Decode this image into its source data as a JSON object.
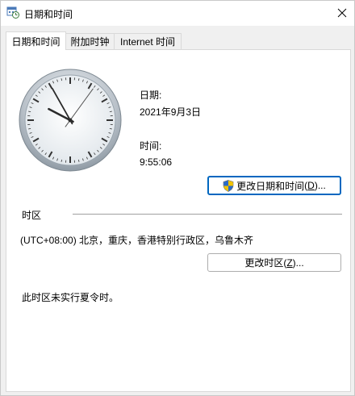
{
  "window": {
    "title": "日期和时间",
    "close_glyph": "✕"
  },
  "tabs": [
    {
      "label": "日期和时间",
      "active": true
    },
    {
      "label": "附加时钟",
      "active": false
    },
    {
      "label": "Internet 时间",
      "active": false
    }
  ],
  "datetime": {
    "date_label": "日期:",
    "date_value": "2021年9月3日",
    "time_label": "时间:",
    "time_value": "9:55:06",
    "change_button_text": "更改日期和时间",
    "change_button_hotkey": "D",
    "change_button_suffix": "...",
    "shield_icon": "uac-shield-icon"
  },
  "timezone": {
    "group_label": "时区",
    "value": "(UTC+08:00) 北京，重庆，香港特别行政区，乌鲁木齐",
    "change_button_text": "更改时区",
    "change_button_hotkey": "Z",
    "change_button_suffix": "...",
    "dst_note": "此时区未实行夏令时。"
  },
  "clock": {
    "hours": 9,
    "minutes": 55,
    "seconds": 6
  },
  "colors": {
    "accent": "#0067c0",
    "panel": "#ffffff",
    "window": "#f0f0f0"
  }
}
